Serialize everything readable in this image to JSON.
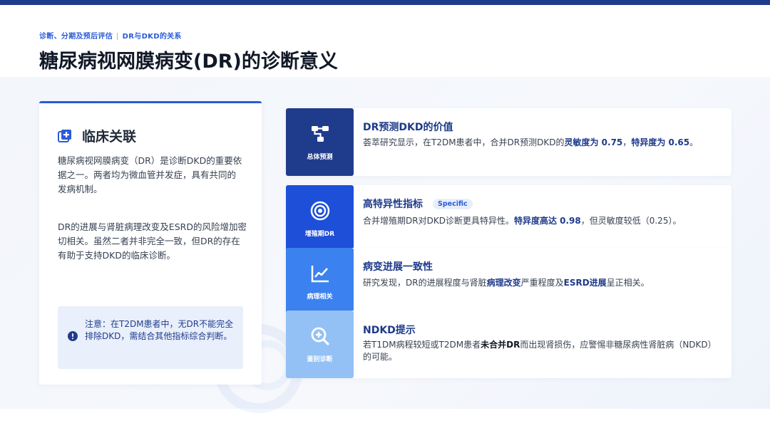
{
  "header": {
    "breadcrumb_section": "诊断、分期及预后评估",
    "breadcrumb_topic": "DR与DKD的关系",
    "title": "糖尿病视网膜病变(DR)的诊断意义"
  },
  "left_card": {
    "title": "临床关联",
    "icon": "medical-plus-icon",
    "paragraph1": "糖尿病视网膜病变（DR）是诊断DKD的重要依据之一。两者均为微血管并发症，具有共同的发病机制。",
    "paragraph2": "DR的进展与肾脏病理改变及ESRD的风险增加密切相关。虽然二者并非完全一致，但DR的存在有助于支持DKD的临床诊断。",
    "note": "注意：在T2DM患者中，无DR不能完全排除DKD，需结合其他指标综合判断。",
    "note_icon": "alert-circle-icon"
  },
  "rows": [
    {
      "badge_label": "总体预测",
      "badge_color": "#1f3c8c",
      "icon": "network-icon",
      "title": "DR预测DKD的价值",
      "desc_pre": "荟萃研究显示，在T2DM患者中，合并DR预测DKD的",
      "desc_hl1": "灵敏度为 0.75",
      "desc_mid": "，",
      "desc_hl2": "特异度为 0.65",
      "desc_post": "。"
    },
    {
      "badge_label": "增殖期DR",
      "badge_color": "#1d4fd8",
      "icon": "target-icon",
      "title": "高特异性指标",
      "tag": "Specific",
      "desc_pre": "合并增殖期DR对DKD诊断更具特异性。",
      "desc_hl1": "特异度高达 0.98",
      "desc_post": "，但灵敏度较低（0.25）。"
    },
    {
      "badge_label": "病理相关",
      "badge_color": "#3b82f0",
      "icon": "trend-line-icon",
      "title": "病变进展一致性",
      "desc_pre": "研究发现，DR的进展程度与肾脏",
      "desc_hl1": "病理改变",
      "desc_mid": "严重程度及",
      "desc_hl2": "ESRD进展",
      "desc_post": "呈正相关。"
    },
    {
      "badge_label": "鉴别诊断",
      "badge_color": "#93c1f5",
      "icon": "search-plus-icon",
      "title": "NDKD提示",
      "desc_pre": "若T1DM病程较短或T2DM患者",
      "desc_hl1": "未合并DR",
      "desc_post": "而出现肾损伤，应警惕非糖尿病性肾脏病（NDKD）的可能。"
    }
  ]
}
